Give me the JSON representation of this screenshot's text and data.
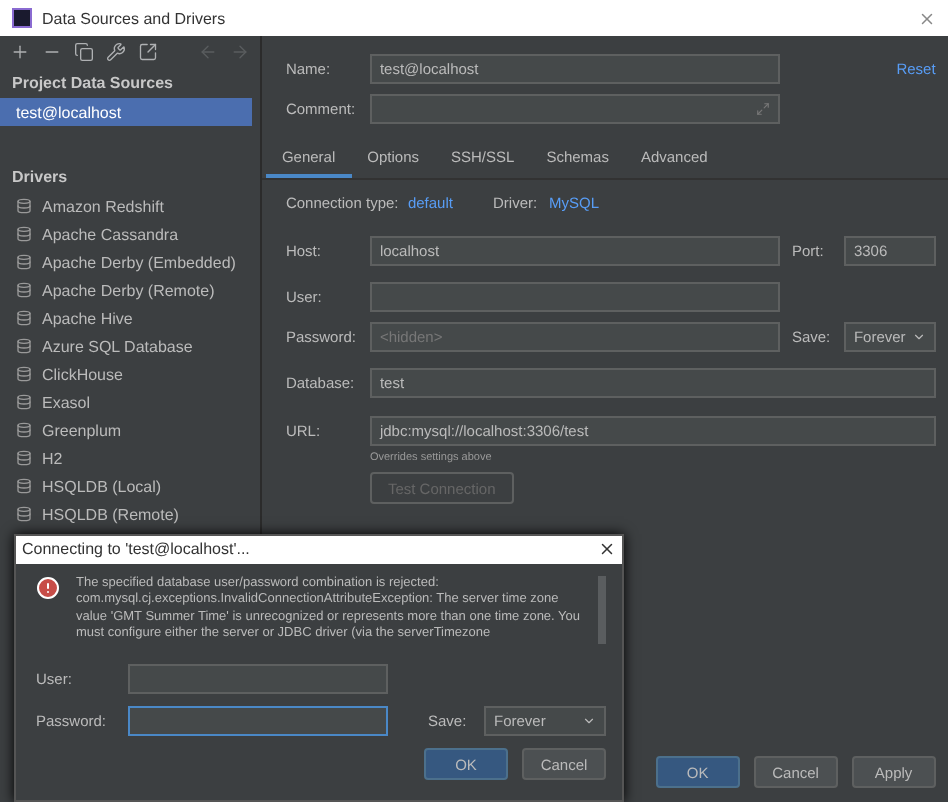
{
  "window": {
    "title": "Data Sources and Drivers"
  },
  "sidebar": {
    "project_heading": "Project Data Sources",
    "project_items": [
      {
        "label": "test@localhost",
        "selected": true
      }
    ],
    "drivers_heading": "Drivers",
    "drivers": [
      {
        "label": "Amazon Redshift"
      },
      {
        "label": "Apache Cassandra"
      },
      {
        "label": "Apache Derby (Embedded)"
      },
      {
        "label": "Apache Derby (Remote)"
      },
      {
        "label": "Apache Hive"
      },
      {
        "label": "Azure SQL Database"
      },
      {
        "label": "ClickHouse"
      },
      {
        "label": "Exasol"
      },
      {
        "label": "Greenplum"
      },
      {
        "label": "H2"
      },
      {
        "label": "HSQLDB (Local)"
      },
      {
        "label": "HSQLDB (Remote)"
      }
    ]
  },
  "form": {
    "name_label": "Name:",
    "name_value": "test@localhost",
    "reset": "Reset",
    "comment_label": "Comment:",
    "tabs": [
      {
        "label": "General",
        "selected": true
      },
      {
        "label": "Options",
        "selected": false
      },
      {
        "label": "SSH/SSL",
        "selected": false
      },
      {
        "label": "Schemas",
        "selected": false
      },
      {
        "label": "Advanced",
        "selected": false
      }
    ],
    "connection_type_label": "Connection type:",
    "connection_type": "default",
    "driver_label": "Driver:",
    "driver": "MySQL",
    "host_label": "Host:",
    "host": "localhost",
    "port_label": "Port:",
    "port": "3306",
    "user_label": "User:",
    "password_label": "Password:",
    "password_placeholder": "<hidden>",
    "save_label": "Save:",
    "save": "Forever",
    "database_label": "Database:",
    "database": "test",
    "url_label": "URL:",
    "url": "jdbc:mysql://localhost:3306/test",
    "url_hint": "Overrides settings above",
    "test_button": {
      "label": "Test Connection",
      "disabled": true
    }
  },
  "buttons": [
    {
      "label": "OK",
      "primary": true
    },
    {
      "label": "Cancel",
      "primary": false
    },
    {
      "label": "Apply",
      "primary": false
    }
  ],
  "dialog": {
    "title": "Connecting to 'test@localhost'...",
    "message": "The specified database user/password combination is rejected: com.mysql.cj.exceptions.InvalidConnectionAttributeException: The server time zone value 'GMT Summer Time' is unrecognized or represents more than one time zone. You must configure either the server or JDBC driver (via the serverTimezone",
    "user_label": "User:",
    "password_label": "Password:",
    "password_focused": true,
    "save_label": "Save:",
    "save": "Forever",
    "buttons": [
      {
        "label": "OK",
        "primary": true
      },
      {
        "label": "Cancel",
        "primary": false
      }
    ]
  }
}
